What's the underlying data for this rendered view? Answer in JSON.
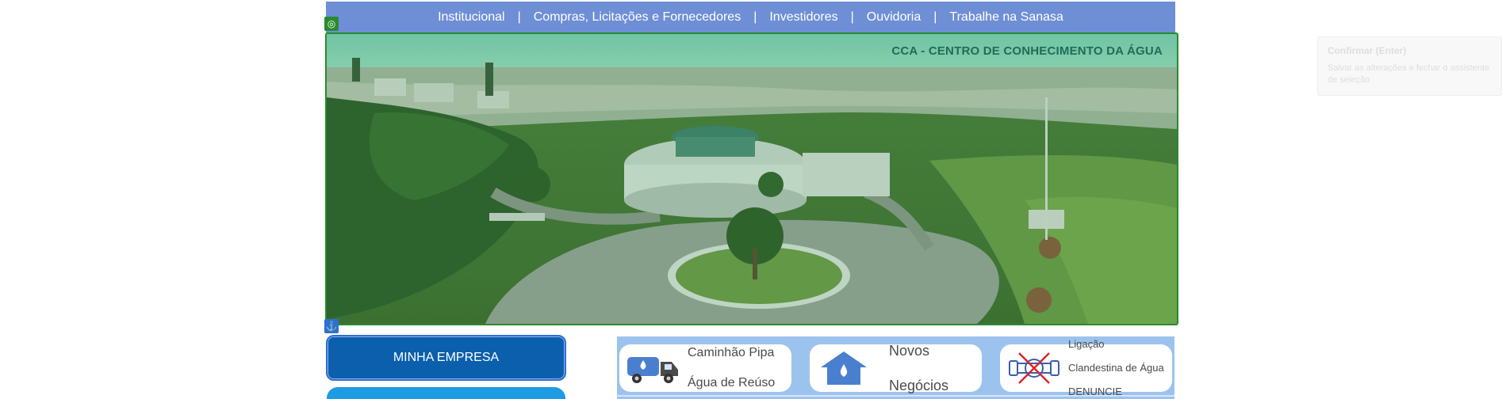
{
  "nav": {
    "items": [
      "Institucional",
      "Compras, Licitações e Fornecedores",
      "Investidores",
      "Ouvidoria",
      "Trabalhe na Sanasa"
    ],
    "separator": "|"
  },
  "hero": {
    "caption": "CCA - CENTRO DE CONHECIMENTO DA ÁGUA"
  },
  "buttons": {
    "minha_empresa": "MINHA EMPRESA"
  },
  "services": [
    {
      "line1": "Caminhão Pipa",
      "line2": "Água de Reúso",
      "line3": "",
      "icon": "water-truck-icon"
    },
    {
      "line1": "Novos",
      "line2": "Negócios",
      "line3": "",
      "icon": "house-drop-icon"
    },
    {
      "line1": "Ligação",
      "line2": "Clandestina de Água",
      "line3": "DENUNCIE",
      "icon": "clandestine-pipe-icon"
    }
  ],
  "ghost_tooltip": {
    "title": "Confirmar (Enter)",
    "desc": "Salvar as alterações e fechar o assistente de seleção"
  },
  "colors": {
    "nav_bg": "#6e8fd6",
    "hero_border": "#2b8a2f",
    "minha_empresa_bg": "#0b5fad",
    "services_bg": "#9cc3ee"
  }
}
